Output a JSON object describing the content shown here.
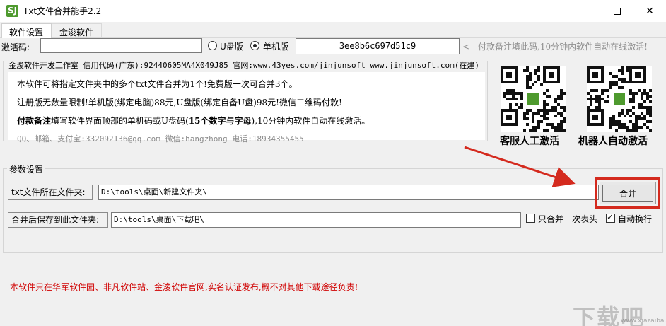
{
  "window": {
    "title": "Txt文件合并能手2.2",
    "icon_text": "SJ",
    "minimize": "minimize",
    "maximize": "maximize",
    "close": "✕"
  },
  "tabs": [
    {
      "label": "软件设置",
      "active": true
    },
    {
      "label": "金浚软件",
      "active": false
    }
  ],
  "registration": {
    "label": "激活码:",
    "value": "",
    "radio_u_label": "U盘版",
    "radio_s_label": "单机版",
    "selected": "单机版",
    "machine_code": "3ee8b6c697d51c9",
    "notice": "<—付款备注填此码,10分钟内软件自动在线激活!"
  },
  "info": {
    "legend": "金浚软件开发工作室 信用代码(广东):92440605MA4X049J85 官网:www.43yes.com/jinjunsoft  www.jinjunsoft.com(在建)",
    "line1": "本软件可将指定文件夹中的多个txt文件合并为1个!免费版一次可合并3个。",
    "line2": "注册版无数量限制!单机版(绑定电脑)88元,U盘版(绑定自备U盘)98元!微信二维码付款!",
    "line3_bold": "付款备注",
    "line3_mid": "填写软件界面顶部的单机码或U盘码(",
    "line3_bold2": "15个数字与字母",
    "line3_end": "),10分钟内软件自动在线激活。",
    "line4": "QQ、邮箱、支付宝:332092136@qq.com   微信:hangzhong   电话:18934355455"
  },
  "qr_codes": [
    {
      "caption": "客服人工激活",
      "icon": "qr-code-icon"
    },
    {
      "caption": "机器人自动激活",
      "icon": "qr-code-icon"
    }
  ],
  "params": {
    "legend": "参数设置",
    "src_label": "txt文件所在文件夹:",
    "src_value": "D:\\tools\\桌面\\新建文件夹\\",
    "dst_label": "合并后保存到此文件夹:",
    "dst_value": "D:\\tools\\桌面\\下载吧\\",
    "merge_button": "合并",
    "check_header_label": "只合并一次表头",
    "check_header": false,
    "check_wrap_label": "自动换行",
    "check_wrap": true
  },
  "disclaimer": "本软件只在华军软件园、非凡软件站、金浚软件官网,实名认证发布,概不对其他下载途径负责!",
  "watermark": {
    "text": "下载吧",
    "sub": "www.xiazaiba.com"
  },
  "colors": {
    "accent_red": "#d42a1e",
    "disclaimer_red": "#d00000",
    "logo_green": "#4e9a2e"
  }
}
